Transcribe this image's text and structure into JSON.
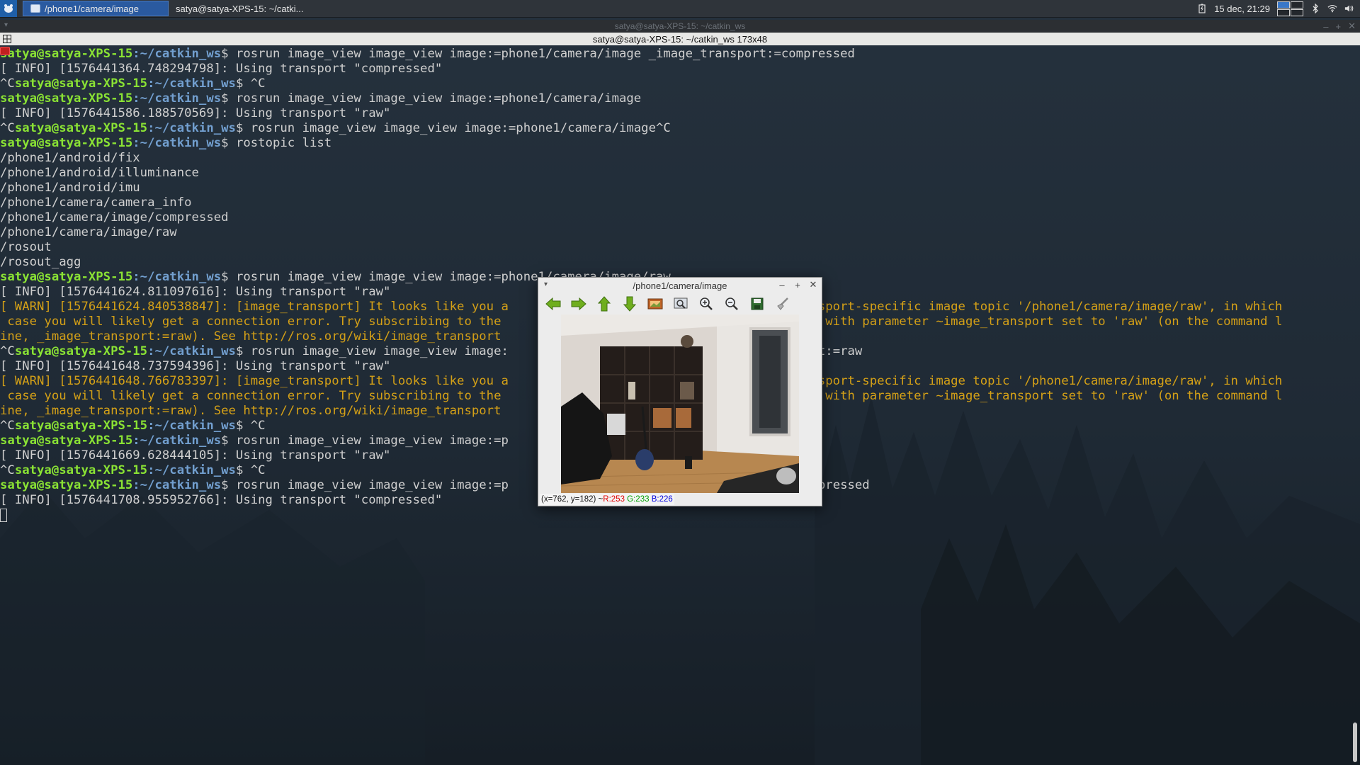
{
  "panel": {
    "tasks": [
      {
        "label": "/phone1/camera/image",
        "active": true
      },
      {
        "label": "satya@satya-XPS-15: ~/catki...",
        "active": false
      }
    ],
    "clock": "15 dec, 21:29"
  },
  "terminal": {
    "title": "satya@satya-XPS-15: ~/catkin_ws",
    "header": "satya@satya-XPS-15: ~/catkin_ws 173x48",
    "lines": [
      {
        "pre": "",
        "user": "satya@satya-XPS-15",
        "path": ":~/catkin_ws",
        "text": "$ rosrun image_view image_view image:=phone1/camera/image _image_transport:=compressed"
      },
      {
        "text": "[ INFO] [1576441364.748294798]: Using transport \"compressed\""
      },
      {
        "pre": "^C",
        "user": "satya@satya-XPS-15",
        "path": ":~/catkin_ws",
        "text": "$ ^C"
      },
      {
        "pre": "",
        "user": "satya@satya-XPS-15",
        "path": ":~/catkin_ws",
        "text": "$ rosrun image_view image_view image:=phone1/camera/image"
      },
      {
        "text": "[ INFO] [1576441586.188570569]: Using transport \"raw\""
      },
      {
        "pre": "^C",
        "user": "satya@satya-XPS-15",
        "path": ":~/catkin_ws",
        "text": "$ rosrun image_view image_view image:=phone1/camera/image^C"
      },
      {
        "pre": "",
        "user": "satya@satya-XPS-15",
        "path": ":~/catkin_ws",
        "text": "$ rostopic list"
      },
      {
        "text": "/phone1/android/fix"
      },
      {
        "text": "/phone1/android/illuminance"
      },
      {
        "text": "/phone1/android/imu"
      },
      {
        "text": "/phone1/camera/camera_info"
      },
      {
        "text": "/phone1/camera/image/compressed"
      },
      {
        "text": "/phone1/camera/image/raw"
      },
      {
        "text": "/rosout"
      },
      {
        "text": "/rosout_agg"
      },
      {
        "pre": "",
        "user": "satya@satya-XPS-15",
        "path": ":~/catkin_ws",
        "text": "$ rosrun image_view image_view image:=phone1/camera/image/raw"
      },
      {
        "text": "[ INFO] [1576441624.811097616]: Using transport \"raw\""
      },
      {
        "warn": true,
        "text": "[ WARN] [1576441624.840538847]: [image_transport] It looks like you a                                      transport-specific image topic '/phone1/camera/image/raw', in which"
      },
      {
        "warn": true,
        "text": " case you will likely get a connection error. Try subscribing to the                                      stead with parameter ~image_transport set to 'raw' (on the command l"
      },
      {
        "warn": true,
        "text": "ine, _image_transport:=raw). See http://ros.org/wiki/image_transport"
      },
      {
        "pre": "^C",
        "user": "satya@satya-XPS-15",
        "path": ":~/catkin_ws",
        "text": "$ rosrun image_view image_view image:                                      sport:=raw"
      },
      {
        "text": "[ INFO] [1576441648.737594396]: Using transport \"raw\""
      },
      {
        "warn": true,
        "text": "[ WARN] [1576441648.766783397]: [image_transport] It looks like you a                                      transport-specific image topic '/phone1/camera/image/raw', in which"
      },
      {
        "warn": true,
        "text": " case you will likely get a connection error. Try subscribing to the                                      stead with parameter ~image_transport set to 'raw' (on the command l"
      },
      {
        "warn": true,
        "text": "ine, _image_transport:=raw). See http://ros.org/wiki/image_transport"
      },
      {
        "pre": "^C",
        "user": "satya@satya-XPS-15",
        "path": ":~/catkin_ws",
        "text": "$ ^C"
      },
      {
        "pre": "",
        "user": "satya@satya-XPS-15",
        "path": ":~/catkin_ws",
        "text": "$ rosrun image_view image_view image:=p                                      =raw"
      },
      {
        "text": "[ INFO] [1576441669.628444105]: Using transport \"raw\""
      },
      {
        "pre": "^C",
        "user": "satya@satya-XPS-15",
        "path": ":~/catkin_ws",
        "text": "$ ^C"
      },
      {
        "pre": "",
        "user": "satya@satya-XPS-15",
        "path": ":~/catkin_ws",
        "text": "$ rosrun image_view image_view image:=p                                      =compressed"
      },
      {
        "text": "[ INFO] [1576441708.955952766]: Using transport \"compressed\""
      }
    ]
  },
  "image_view": {
    "title": "/phone1/camera/image",
    "toolbar": [
      "back-icon",
      "forward-icon",
      "up-icon",
      "down-icon",
      "picture-icon",
      "fit-icon",
      "zoom-in-icon",
      "zoom-out-icon",
      "save-icon",
      "clear-icon"
    ],
    "status": {
      "coords": "(x=762, y=182) ~ ",
      "r": "R:253",
      "g": "G:233",
      "b": "B:226"
    }
  },
  "colors": {
    "prompt_user": "#8ae234",
    "prompt_path": "#729fcf",
    "warn": "#d4a017",
    "panel": "#2f343a",
    "active_task": "#2a5aa0"
  }
}
